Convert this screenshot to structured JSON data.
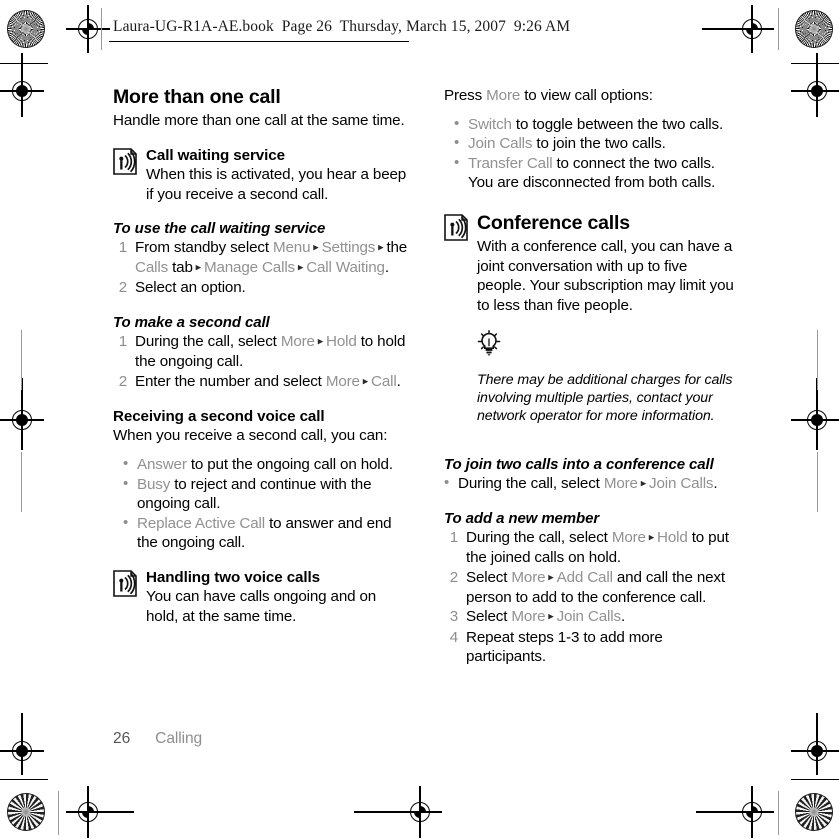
{
  "header": {
    "text": "Laura-UG-R1A-AE.book  Page 26  Thursday, March 15, 2007  9:26 AM"
  },
  "footer": {
    "page_number": "26",
    "section": "Calling"
  },
  "colors": {
    "ui_reference_grey": "#919191",
    "body_text": "#000000",
    "step_number_grey": "#8e8e8e"
  },
  "icons": {
    "note": "signal-note-icon",
    "tip": "lightbulb-tip-icon",
    "registration_rosette": "registration-rosette-mark",
    "registration_target": "registration-crosshair-mark"
  },
  "left_column": {
    "title": "More than one call",
    "intro": "Handle more than one call at the same time.",
    "call_waiting": {
      "heading": "Call waiting service",
      "body": "When this is activated, you hear a beep if you receive a second call."
    },
    "proc_use_call_waiting": {
      "heading": "To use the call waiting service",
      "steps": [
        {
          "num": "1",
          "parts": [
            {
              "t": "From standby select ",
              "s": "plain"
            },
            {
              "t": "Menu",
              "s": "ui"
            },
            {
              "t": " ▸ ",
              "s": "arrow"
            },
            {
              "t": "Settings",
              "s": "ui"
            },
            {
              "t": " ▸ ",
              "s": "arrow"
            },
            {
              "t": "the ",
              "s": "plain"
            },
            {
              "t": "Calls",
              "s": "ui"
            },
            {
              "t": " tab",
              "s": "plain"
            },
            {
              "t": " ▸ ",
              "s": "arrow"
            },
            {
              "t": "Manage Calls",
              "s": "ui"
            },
            {
              "t": " ▸ ",
              "s": "arrow"
            },
            {
              "t": "Call Waiting",
              "s": "ui"
            },
            {
              "t": ".",
              "s": "plain"
            }
          ]
        },
        {
          "num": "2",
          "parts": [
            {
              "t": "Select an option.",
              "s": "plain"
            }
          ]
        }
      ]
    },
    "proc_second_call": {
      "heading": "To make a second call",
      "steps": [
        {
          "num": "1",
          "parts": [
            {
              "t": "During the call, select ",
              "s": "plain"
            },
            {
              "t": "More",
              "s": "ui"
            },
            {
              "t": " ▸ ",
              "s": "arrow"
            },
            {
              "t": "Hold",
              "s": "ui"
            },
            {
              "t": " to hold the ongoing call.",
              "s": "plain"
            }
          ]
        },
        {
          "num": "2",
          "parts": [
            {
              "t": "Enter the number and select ",
              "s": "plain"
            },
            {
              "t": "More",
              "s": "ui"
            },
            {
              "t": " ▸ ",
              "s": "arrow"
            },
            {
              "t": "Call",
              "s": "ui"
            },
            {
              "t": ".",
              "s": "plain"
            }
          ]
        }
      ]
    },
    "receiving_second": {
      "heading": "Receiving a second voice call",
      "body": "When you receive a second call, you can:",
      "bullets": [
        [
          {
            "t": "Answer",
            "s": "ui"
          },
          {
            "t": " to put the ongoing call on hold.",
            "s": "plain"
          }
        ],
        [
          {
            "t": "Busy",
            "s": "ui"
          },
          {
            "t": " to reject and continue with the ongoing call.",
            "s": "plain"
          }
        ],
        [
          {
            "t": "Replace Active Call",
            "s": "ui"
          },
          {
            "t": " to answer and end the ongoing call.",
            "s": "plain"
          }
        ]
      ]
    },
    "handling_two": {
      "heading": "Handling two voice calls",
      "body": "You can have calls ongoing and on hold, at the same time."
    }
  },
  "right_column": {
    "press_more": [
      {
        "t": "Press ",
        "s": "plain"
      },
      {
        "t": "More",
        "s": "ui"
      },
      {
        "t": " to view call options:",
        "s": "plain"
      }
    ],
    "options_bullets": [
      [
        {
          "t": "Switch",
          "s": "ui"
        },
        {
          "t": " to toggle between the two calls.",
          "s": "plain"
        }
      ],
      [
        {
          "t": "Join Calls",
          "s": "ui"
        },
        {
          "t": " to join the two calls.",
          "s": "plain"
        }
      ],
      [
        {
          "t": "Transfer Call",
          "s": "ui"
        },
        {
          "t": " to connect the two calls. You are disconnected from both calls.",
          "s": "plain"
        }
      ]
    ],
    "conference": {
      "heading": "Conference calls",
      "body": "With a conference call, you can have a joint conversation with up to five people. Your subscription may limit you to less than five people."
    },
    "tip": "There may be additional charges for calls involving multiple parties, contact your network operator for more information.",
    "proc_join_two": {
      "heading": "To join two calls into a conference call",
      "bullets": [
        [
          {
            "t": "During the call, select ",
            "s": "plain"
          },
          {
            "t": "More",
            "s": "ui"
          },
          {
            "t": " ▸ ",
            "s": "arrow"
          },
          {
            "t": "Join Calls",
            "s": "ui"
          },
          {
            "t": ".",
            "s": "plain"
          }
        ]
      ]
    },
    "proc_add_member": {
      "heading": "To add a new member",
      "steps": [
        {
          "num": "1",
          "parts": [
            {
              "t": "During the call, select ",
              "s": "plain"
            },
            {
              "t": "More",
              "s": "ui"
            },
            {
              "t": " ▸ ",
              "s": "arrow"
            },
            {
              "t": "Hold",
              "s": "ui"
            },
            {
              "t": " to put the joined calls on hold.",
              "s": "plain"
            }
          ]
        },
        {
          "num": "2",
          "parts": [
            {
              "t": "Select ",
              "s": "plain"
            },
            {
              "t": "More",
              "s": "ui"
            },
            {
              "t": " ▸ ",
              "s": "arrow"
            },
            {
              "t": "Add Call",
              "s": "ui"
            },
            {
              "t": " and call the next person to add to the conference call.",
              "s": "plain"
            }
          ]
        },
        {
          "num": "3",
          "parts": [
            {
              "t": "Select ",
              "s": "plain"
            },
            {
              "t": "More",
              "s": "ui"
            },
            {
              "t": " ▸ ",
              "s": "arrow"
            },
            {
              "t": "Join Calls",
              "s": "ui"
            },
            {
              "t": ".",
              "s": "plain"
            }
          ]
        },
        {
          "num": "4",
          "parts": [
            {
              "t": "Repeat steps 1-3 to add more participants.",
              "s": "plain"
            }
          ]
        }
      ]
    }
  }
}
